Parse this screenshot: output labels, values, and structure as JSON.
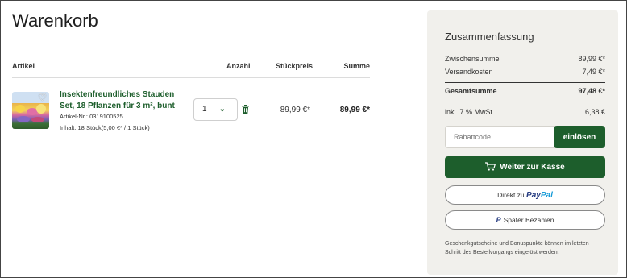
{
  "page": {
    "title": "Warenkorb"
  },
  "cart": {
    "headers": {
      "artikel": "Artikel",
      "anzahl": "Anzahl",
      "preis": "Stückpreis",
      "summe": "Summe"
    },
    "items": [
      {
        "name": "Insektenfreundliches Stauden Set, 18 Pflanzen für 3 m², bunt",
        "sku": "Artikel-Nr.: 0319100525",
        "content": "Inhalt: 18 Stück(5,00 €* / 1 Stück)",
        "quantity": "1",
        "unit_price": "89,99 €*",
        "line_total": "89,99 €*"
      }
    ]
  },
  "summary": {
    "title": "Zusammenfassung",
    "subtotal_label": "Zwischensumme",
    "subtotal_value": "89,99 €*",
    "shipping_label": "Versandkosten",
    "shipping_value": "7,49 €*",
    "total_label": "Gesamtsumme",
    "total_value": "97,48 €*",
    "vat_label": "inkl. 7 % MwSt.",
    "vat_value": "6,38 €",
    "coupon_placeholder": "Rabattcode",
    "coupon_button": "einlösen",
    "checkout_button": "Weiter zur Kasse",
    "paypal_prefix": "Direkt zu",
    "paypal_pay": "Pay",
    "paypal_pal": "Pal",
    "paylater_icon": "P",
    "paylater_label": "Später Bezahlen",
    "footnote": "Geschenkgutscheine und Bonuspunkte können im letzten Schritt des Bestellvorgangs eingelöst werden."
  },
  "icons": {
    "favorite": "heart-icon",
    "delete": "trash-icon",
    "dropdown": "chevron-down-icon",
    "cart": "cart-icon",
    "paypal": "paypal-icon"
  },
  "colors": {
    "brand_green": "#1d5e2c",
    "summary_bg": "#f1f0ec",
    "paypal_dark": "#253b80",
    "paypal_light": "#179bd7"
  }
}
